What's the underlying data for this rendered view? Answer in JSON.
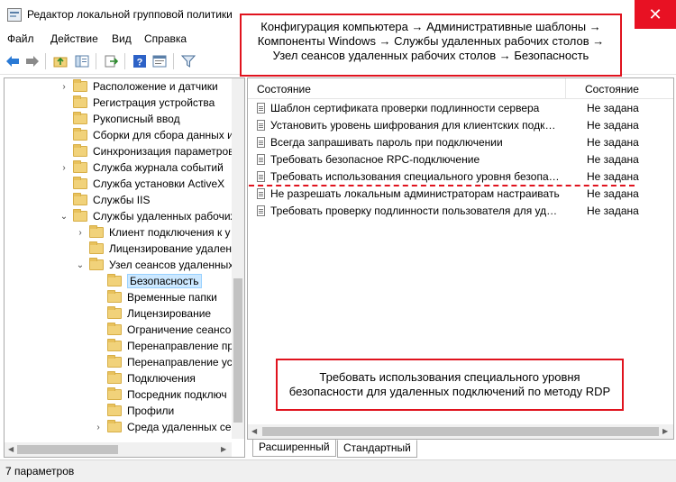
{
  "window": {
    "title": "Редактор локальной групповой политики",
    "close_symbol": "✕"
  },
  "menu": [
    "Файл",
    "Действие",
    "Вид",
    "Справка"
  ],
  "toolbar": {
    "icons": [
      "back-arrow-icon",
      "forward-arrow-icon",
      "up-folder-icon",
      "show-hide-tree-icon",
      "export-list-icon",
      "help-icon",
      "properties-icon",
      "filter-icon"
    ]
  },
  "tree": {
    "items": [
      {
        "label": "Расположение и датчики",
        "chevron": "›"
      },
      {
        "label": "Регистрация устройства",
        "chevron": ""
      },
      {
        "label": "Рукописный ввод",
        "chevron": ""
      },
      {
        "label": "Сборки для сбора данных и",
        "chevron": ""
      },
      {
        "label": "Синхронизация параметров",
        "chevron": ""
      },
      {
        "label": "Служба журнала событий",
        "chevron": "›"
      },
      {
        "label": "Служба установки ActiveX",
        "chevron": ""
      },
      {
        "label": "Службы IIS",
        "chevron": ""
      },
      {
        "label": "Службы удаленных рабочих",
        "chevron": "⌄"
      },
      {
        "label": "Клиент подключения к у",
        "chevron": "›"
      },
      {
        "label": "Лицензирование удален",
        "chevron": ""
      },
      {
        "label": "Узел сеансов удаленных",
        "chevron": "⌄"
      },
      {
        "label": "Безопасность",
        "chevron": "",
        "selected": true
      },
      {
        "label": "Временные папки",
        "chevron": ""
      },
      {
        "label": "Лицензирование",
        "chevron": ""
      },
      {
        "label": "Ограничение сеансов",
        "chevron": ""
      },
      {
        "label": "Перенаправление пр",
        "chevron": ""
      },
      {
        "label": "Перенаправление ус",
        "chevron": ""
      },
      {
        "label": "Подключения",
        "chevron": ""
      },
      {
        "label": "Посредник подключ",
        "chevron": ""
      },
      {
        "label": "Профили",
        "chevron": ""
      },
      {
        "label": "Среда удаленных се",
        "chevron": ""
      }
    ]
  },
  "list": {
    "col_setting": "Состояние",
    "col_state": "Состояние",
    "rows": [
      {
        "name": "Шаблон сертификата проверки подлинности сервера",
        "state": "Не задана"
      },
      {
        "name": "Установить уровень шифрования для клиентских подключений",
        "state": "Не задана"
      },
      {
        "name": "Всегда запрашивать пароль при подключении",
        "state": "Не задана"
      },
      {
        "name": "Требовать безопасное RPC-подключение",
        "state": "Не задана"
      },
      {
        "name": "Требовать использования специального уровня безопасности",
        "state": "Не задана"
      },
      {
        "name": "Не разрешать локальным администраторам настраивать",
        "state": "Не задана"
      },
      {
        "name": "Требовать проверку подлинности пользователя для удаленных",
        "state": "Не задана"
      }
    ]
  },
  "tabs": {
    "extended": "Расширенный",
    "standard": "Стандартный"
  },
  "status": {
    "text": "7 параметров"
  },
  "annotations": {
    "path_line1": "Конфигурация компьютера → Административные шаблоны →",
    "path_line2": "Компоненты Windows → Службы удаленных рабочих столов →",
    "path_line3": "Узел сеансов удаленных рабочих столов → Безопасность",
    "desc_line1": "Требовать использования специального уровня",
    "desc_line2": "безопасности для удаленных подключений по методу RDP"
  },
  "colors": {
    "accent_red": "#e0131e",
    "selection": "#cce8ff",
    "close_button": "#e81123"
  }
}
